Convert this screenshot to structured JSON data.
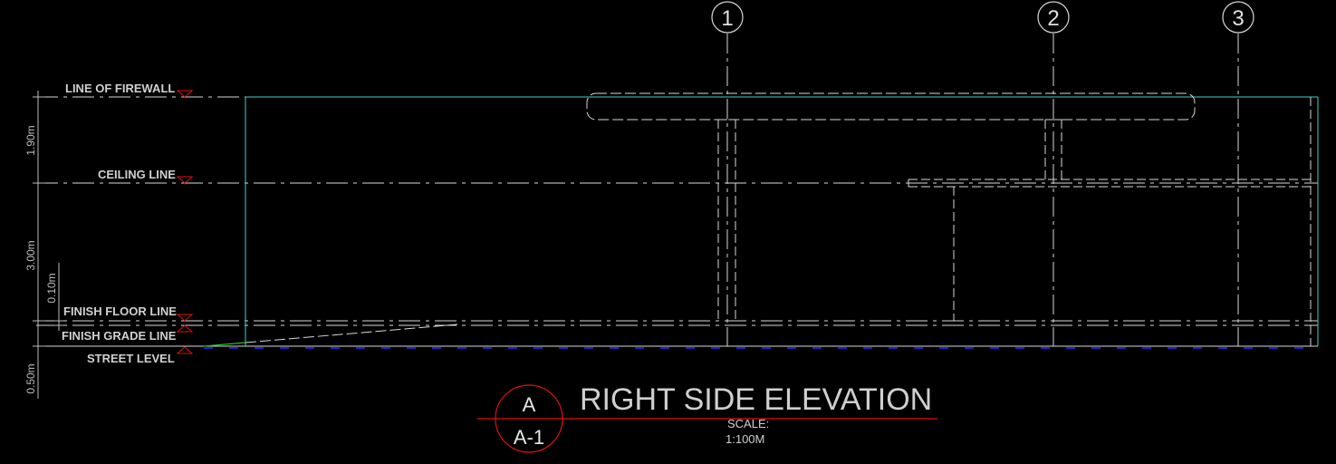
{
  "levels": {
    "firewall": "LINE OF FIREWALL",
    "ceiling": "CEILING LINE",
    "floor": "FINISH FLOOR LINE",
    "grade": "FINISH GRADE LINE",
    "street": "STREET LEVEL"
  },
  "dimensions": {
    "d1": "1.90m",
    "d2": "3.00m",
    "d3": "0.10m",
    "d4": "0.50m"
  },
  "grid": [
    "1",
    "2",
    "3"
  ],
  "title": {
    "text": "RIGHT SIDE ELEVATION",
    "bubble_top": "A",
    "bubble_bottom": "A-1",
    "scale_label": "SCALE:",
    "scale_value": "1:100M"
  },
  "colors": {
    "background": "#000000",
    "lines": "#d9d9d9",
    "cyan": "#3fd0d0",
    "red": "#e01010",
    "blue": "#2020c8",
    "green": "#20c020"
  }
}
